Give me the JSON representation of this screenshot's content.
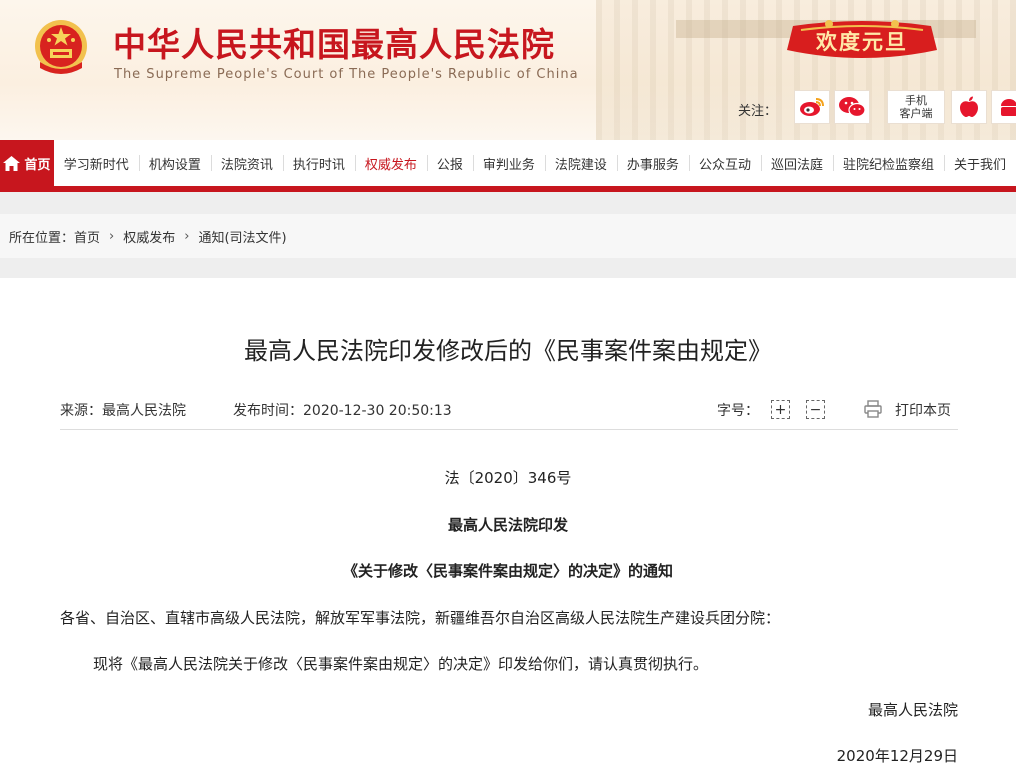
{
  "header": {
    "title": "中华人民共和国最高人民法院",
    "subtitle": "The Supreme People's Court of The People's Republic of China",
    "banner": "欢度元旦",
    "follow_label": "关注：",
    "app_label_line1": "手机",
    "app_label_line2": "客户端",
    "icons": [
      "national-emblem",
      "weibo-icon",
      "wechat-icon",
      "apple-icon",
      "android-icon"
    ]
  },
  "nav": {
    "home": "首页",
    "items": [
      "学习新时代",
      "机构设置",
      "法院资讯",
      "执行时讯",
      "权威发布",
      "公报",
      "审判业务",
      "法院建设",
      "办事服务",
      "公众互动",
      "巡回法庭",
      "驻院纪检监察组",
      "关于我们"
    ],
    "active_index": 4
  },
  "breadcrumb": {
    "label": "所在位置：",
    "items": [
      "首页",
      "权威发布",
      "通知(司法文件)"
    ]
  },
  "article": {
    "title": "最高人民法院印发修改后的《民事案件案由规定》",
    "source": "来源：最高人民法院",
    "publish": "发布时间：2020-12-30 20:50:13",
    "font_size_label": "字号：",
    "font_plus": "+",
    "font_minus": "−",
    "print": "打印本页",
    "doc_number": "法〔2020〕346号",
    "heading1": "最高人民法院印发",
    "heading2": "《关于修改〈民事案件案由规定〉的决定》的通知",
    "salutation": "各省、自治区、直辖市高级人民法院，解放军军事法院，新疆维吾尔自治区高级人民法院生产建设兵团分院：",
    "body": "现将《最高人民法院关于修改〈民事案件案由规定〉的决定》印发给你们，请认真贯彻执行。",
    "signature": "最高人民法院",
    "date": "2020年12月29日"
  },
  "colors": {
    "brand_red": "#c7161e",
    "header_bg": "#fbefe0",
    "gold": "#f2c14e"
  }
}
